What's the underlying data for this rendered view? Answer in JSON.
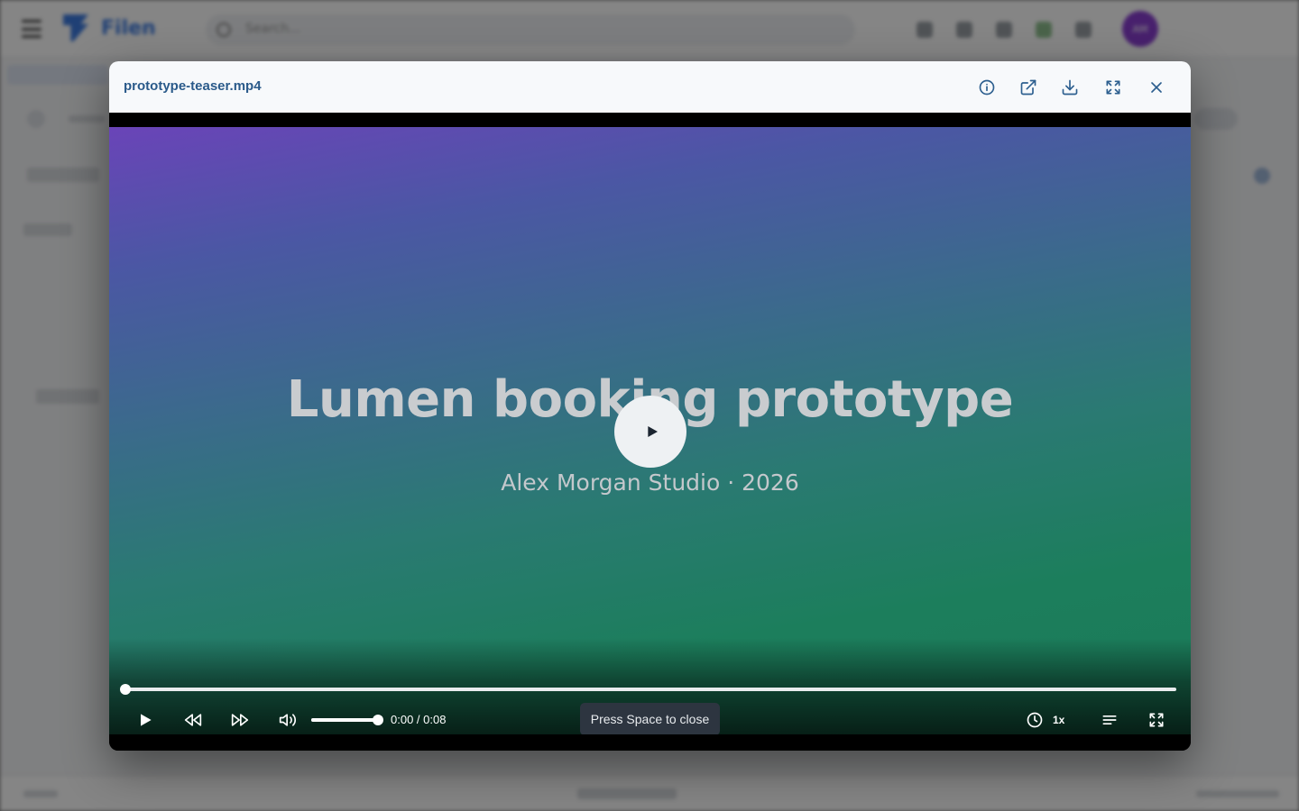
{
  "background": {
    "logo_text": "Filen",
    "search_placeholder": "Search...",
    "avatar_initials": "AM"
  },
  "modal": {
    "title": "prototype-teaser.mp4",
    "header_icons": [
      "info-icon",
      "open-external-icon",
      "download-icon",
      "expand-icon",
      "close-icon"
    ]
  },
  "video": {
    "title": "Lumen booking prototype",
    "subtitle": "Alex Morgan Studio · 2026",
    "time_display": "0:00 / 0:08",
    "progress": 0,
    "volume": 1,
    "speed_label": "1x",
    "hint": "Press Space to close"
  },
  "colors": {
    "header_accent": "#2d5f8f",
    "avatar": "#8a3fd1"
  }
}
